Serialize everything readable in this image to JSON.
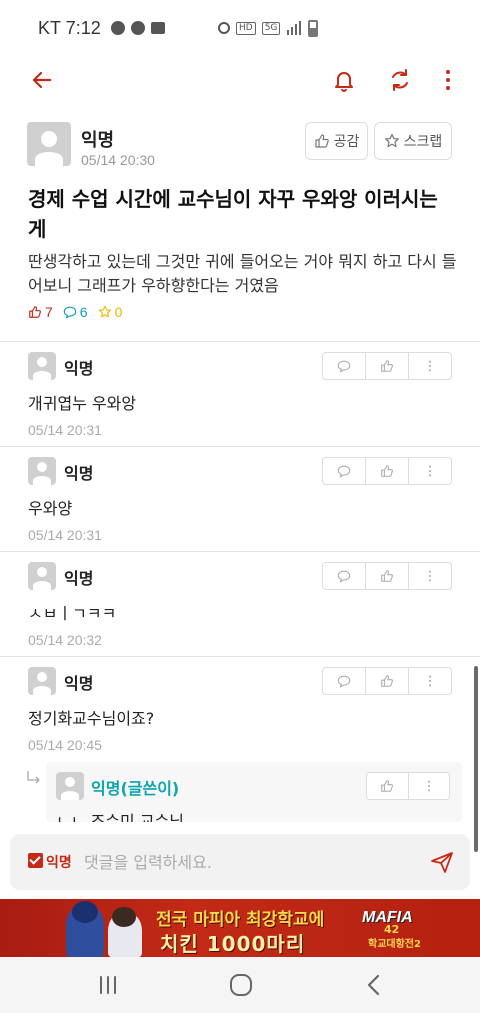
{
  "status_bar": {
    "carrier_time": "KT 7:12",
    "network": "5G",
    "hd": "HD"
  },
  "toolbar": {
    "back_icon": "back-arrow-icon",
    "bell_icon": "bell-icon",
    "refresh_icon": "refresh-icon",
    "more_icon": "more-vert-icon",
    "accent_color": "#c62917"
  },
  "post": {
    "author": "익명",
    "date": "05/14 20:30",
    "like_label": "공감",
    "scrap_label": "스크랩",
    "title": "경제 수업 시간에 교수님이 자꾸 우와앙 이러시는 게",
    "body": "딴생각하고 있는데 그것만 귀에 들어오는 거야 뭐지 하고 다시 들어보니 그래프가 우하향한다는 거였음",
    "like_count": "7",
    "comment_count": "6",
    "scrap_count": "0"
  },
  "comments": [
    {
      "author": "익명",
      "text": "개귀엽누 우와앙",
      "date": "05/14 20:31"
    },
    {
      "author": "익명",
      "text": "우와양",
      "date": "05/14 20:31"
    },
    {
      "author": "익명",
      "text": "ㅅㅂㅣㄱㅋㅋ",
      "date": "05/14 20:32"
    },
    {
      "author": "익명",
      "text": "정기화교수님이죠?",
      "date": "05/14 20:45"
    }
  ],
  "reply": {
    "author": "익명(글쓴이)",
    "text": "ㄴㄴ 조수미 교수님"
  },
  "input_bar": {
    "anon_label": "익명",
    "placeholder": "댓글을 입력하세요."
  },
  "ad": {
    "line1": "전국 마피아 최강학교에",
    "line2": "치킨 1000마리",
    "logo_title": "MAFIA",
    "logo_num": "42",
    "logo_sub": "학교대항전2"
  },
  "colors": {
    "accent": "#c62917",
    "teal": "#0ca5b0",
    "yellow": "#f2b600"
  }
}
